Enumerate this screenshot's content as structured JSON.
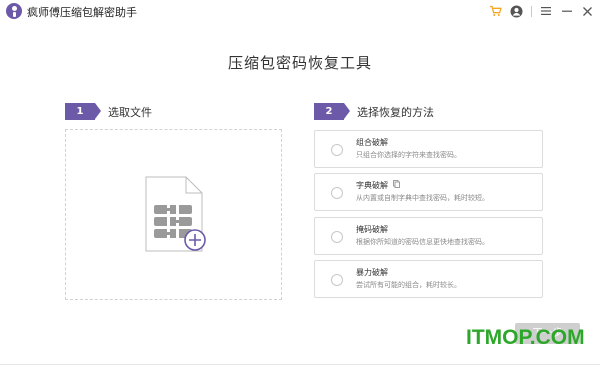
{
  "app": {
    "title": "疯师傅压缩包解密助手"
  },
  "titlebar": {
    "icons": [
      "cart-icon",
      "user-icon",
      "menu-icon",
      "minimize-icon",
      "close-icon"
    ],
    "accent_color": "#f5a623"
  },
  "main": {
    "heading": "压缩包密码恢复工具"
  },
  "step1": {
    "number": "1",
    "label": "选取文件"
  },
  "step2": {
    "number": "2",
    "label": "选择恢复的方法"
  },
  "dropzone": {
    "icon": "archive-file-add-icon"
  },
  "methods": [
    {
      "title": "组合破解",
      "desc": "只组合你选择的字符来查找密码。"
    },
    {
      "title": "字典破解",
      "desc": "从内置或自制字典中查找密码，耗时较短。"
    },
    {
      "title": "掩码破解",
      "desc": "根据你所知道的密码信息更快地查找密码。"
    },
    {
      "title": "暴力破解",
      "desc": "尝试所有可能的组合，耗时较长。"
    }
  ],
  "next_button": {
    "label": "下一步"
  },
  "watermark": {
    "text": "ITMOP.COM"
  },
  "colors": {
    "brand": "#6c5aa8",
    "watermark": "#2da72a",
    "button_disabled": "#cfcfcf"
  }
}
